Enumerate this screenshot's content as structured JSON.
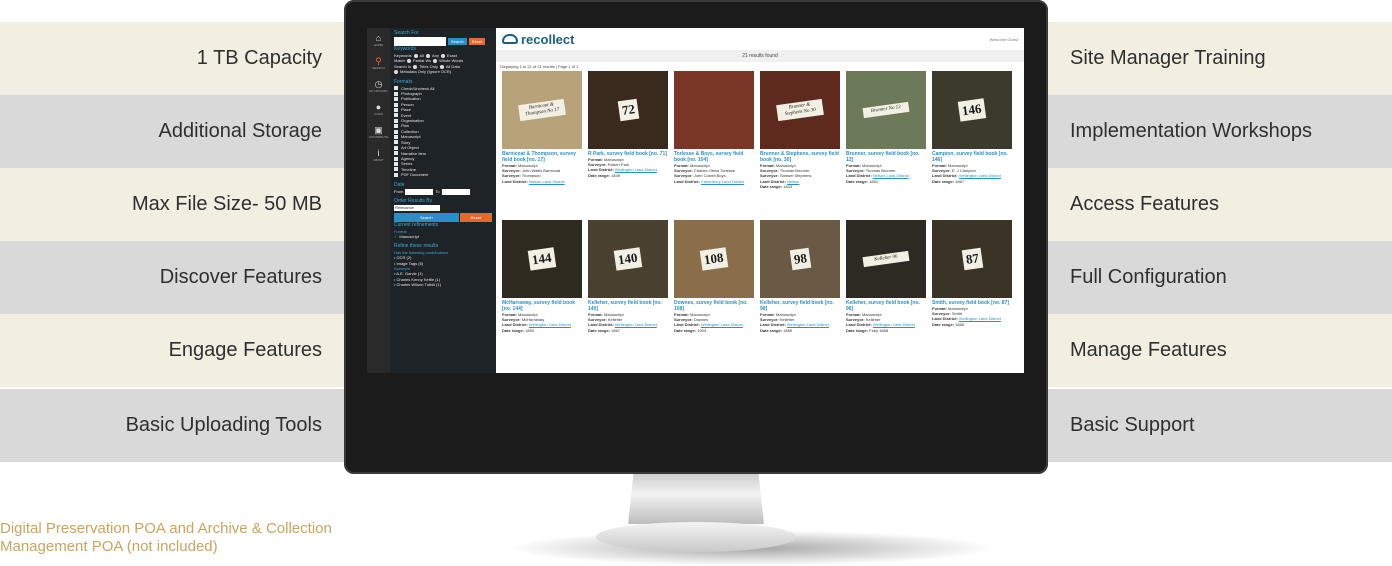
{
  "features_left": [
    "1 TB Capacity",
    "Additional Storage",
    "Max File Size- 50 MB",
    "Discover Features",
    "Engage Features",
    "Basic Uploading Tools"
  ],
  "features_right": [
    "Site Manager Training",
    "Implementation Workshops",
    "Access Features",
    "Full Configuration",
    "Manage Features",
    "Basic Support"
  ],
  "footnote": "Digital Preservation POA and Archive & Collection Management POA (not included)",
  "colors": {
    "band_cream": "#f2eee1",
    "band_grey": "#d9d9d9",
    "footnote": "#c9a45e",
    "accent_blue": "#2a8fc9",
    "accent_orange": "#e8682b",
    "brand": "#1b5f86"
  },
  "app": {
    "rail": [
      {
        "icon": "home-icon",
        "glyph": "⌂",
        "label": "HOME"
      },
      {
        "icon": "search-icon",
        "glyph": "⚲",
        "label": "SEARCH"
      },
      {
        "icon": "history-icon",
        "glyph": "◷",
        "label": "MY HISTORY"
      },
      {
        "icon": "user-icon",
        "glyph": "●",
        "label": "LOGIN"
      },
      {
        "icon": "image-icon",
        "glyph": "▣",
        "label": "CONTRIBUTE"
      },
      {
        "icon": "info-icon",
        "glyph": "i",
        "label": "ABOUT"
      }
    ],
    "panel": {
      "search_for": "Search For",
      "search_btn": "Search",
      "reset_btn": "Reset",
      "keywords_hd": "Keywords",
      "keywords_label": "Keywords",
      "keywords_opts": [
        "All",
        "Any",
        "Exact"
      ],
      "match_label": "Match",
      "match_opts": [
        "Partial Ws",
        "Whole Words"
      ],
      "search_in_label": "Search In",
      "search_in_opts": [
        "Titles Only",
        "All Data"
      ],
      "metadata_only": "Metadata Only (Ignore OCR)",
      "formats_hd": "Formats",
      "formats": [
        "Check/Uncheck All",
        "Photograph",
        "Publication",
        "Person",
        "Place",
        "Event",
        "Organisation",
        "Plan",
        "Collection",
        "Manuscript",
        "Story",
        "Art Object",
        "Narrative Item",
        "Agency",
        "Series",
        "Timeline",
        "PDF Document"
      ],
      "date_hd": "Date",
      "date_from": "From",
      "date_to": "To",
      "order_hd": "Order Results By",
      "order_value": "Relevance",
      "search_wide": "Search",
      "reset_wide": "Reset",
      "current_refinements_hd": "Current refinements",
      "format_label": "Format",
      "refinement_value": "Manuscript",
      "refine_hd": "Refine these results",
      "contributions_hd": "Has the following contributions",
      "contributions": [
        "OCR (2)",
        "Image Tags (5)"
      ],
      "surveyor_hd": "Surveyor",
      "surveyors": [
        "A.E. Garvie (1)",
        "Charles Kenny Kettle (1)",
        "Charles Wilson Tuthill (1)"
      ]
    },
    "brand": "recollect",
    "welcome": "Welcome Guest",
    "results_found": "21 results found",
    "displaying": "Displaying 1 to 21 of 21 results | Page 1 of 1",
    "field_labels": {
      "format": "Format:",
      "surveyor": "Surveyor:",
      "land_district": "Land District:",
      "date_range": "Date range:"
    },
    "cards": [
      {
        "title": "Barnicoat & Thompson, survey field book [no. 17]",
        "format": "Manuscript",
        "surveyor": "John Wallis Barnicoat",
        "surveyor2": "Thompson",
        "district": "Nelson Land District",
        "date": "",
        "label": "Barnicoat & Thompson No 17",
        "label_style": "script",
        "bg": "#b8a27a"
      },
      {
        "title": "R Park, survey field book [no. 71]",
        "format": "Manuscript",
        "surveyor": "Robert Park",
        "district": "Wellington Land District",
        "date": "1849",
        "label": "72",
        "label_style": "number",
        "bg": "#3a2a1d"
      },
      {
        "title": "Torlesse & Boys, survey field book [no. 104]",
        "format": "Manuscript",
        "surveyor": "Charles Obins Torlesse",
        "surveyor2": "John Cowell Boys",
        "district": "Canterbury Land District",
        "date": "",
        "label": "",
        "label_style": "none",
        "bg": "#7a3626"
      },
      {
        "title": "Brunner & Stephens, survey field book [no. 30]",
        "format": "Manuscript",
        "surveyor": "Thomas Brunner",
        "surveyor2": "Samuel Stephens",
        "district": "Nelson",
        "date": "1843",
        "label": "Brunner & Stephens No 30",
        "label_style": "script",
        "bg": "#5e2a1e"
      },
      {
        "title": "Brunner, survey field book [no. 12]",
        "format": "Manuscript",
        "surveyor": "Thomas Brunner",
        "district": "Nelson Land District",
        "date": "1881",
        "label": "Brunner No 12",
        "label_style": "script",
        "bg": "#6d7a5a"
      },
      {
        "title": "Campion, survey field book [no. 146]",
        "format": "Manuscript",
        "surveyor": "E. J Campion",
        "district": "Wellington Land District",
        "date": "1867",
        "label": "146",
        "label_style": "number",
        "bg": "#3c3a2c"
      },
      {
        "title": "McHarraway, survey field book [no. 144]",
        "format": "Manuscript",
        "surveyor": "McHarraway",
        "district": "Wellington Land District",
        "date": "1853",
        "label": "144",
        "label_style": "number",
        "bg": "#2e2a20"
      },
      {
        "title": "Kelleher, survey field book [no. 140]",
        "format": "Manuscript",
        "surveyor": "Kelleher",
        "district": "Wellington Land District",
        "date": "1867",
        "label": "140",
        "label_style": "number",
        "bg": "#4a4030"
      },
      {
        "title": "Downes, survey field book [no. 108]",
        "format": "Manuscript",
        "surveyor": "Downes",
        "district": "Wellington Land District",
        "date": "1903",
        "label": "108",
        "label_style": "number",
        "bg": "#8a6e4a"
      },
      {
        "title": "Kelleher, survey field book [no. 98]",
        "format": "Manuscript",
        "surveyor": "Kelleher",
        "district": "Wellington Land District",
        "date": "1889",
        "label": "98",
        "label_style": "number",
        "bg": "#6a5a44"
      },
      {
        "title": "Kelleher, survey field book [no. 96]",
        "format": "Manuscript",
        "surveyor": "Kelleher",
        "district": "Wellington Land District",
        "date": "Feby 1868",
        "label": "Kelleher 96",
        "label_style": "script",
        "bg": "#2c2a22"
      },
      {
        "title": "Smith, survey field book [no. 87]",
        "format": "Manuscript",
        "surveyor": "Smith",
        "district": "Wellington Land District",
        "date": "1865",
        "label": "87",
        "label_style": "number",
        "bg": "#3a3426"
      }
    ]
  }
}
